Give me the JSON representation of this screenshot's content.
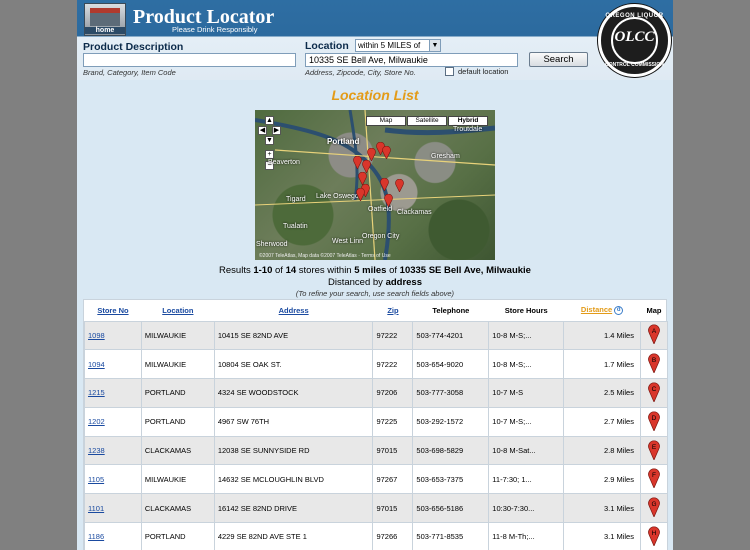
{
  "header": {
    "home_label": "home",
    "title": "Product Locator",
    "subtitle": "Please Drink Responsibly",
    "seal_top": "OREGON LIQUOR",
    "seal_center": "OLCC",
    "seal_bottom": "CONTROL COMMISSION"
  },
  "search": {
    "product_label": "Product Description",
    "product_value": "",
    "product_hint": "Brand, Category, Item Code",
    "location_label": "Location",
    "radius_value": "within 5 MILES of",
    "location_value": "10335 SE Bell Ave, Milwaukie",
    "location_hint": "Address, Zipcode, City, Store No.",
    "default_label": "default location",
    "default_checked": false,
    "button_label": "Search"
  },
  "list_title": "Location List",
  "map": {
    "buttons": [
      "Map",
      "Satellite",
      "Hybrid"
    ],
    "selected": "Hybrid",
    "places": [
      "Portland",
      "Gresham",
      "Beaverton",
      "Tigard",
      "Lake Oswego",
      "Tualatin",
      "Clackamas",
      "Oatfield",
      "Troutdale",
      "Sherwood",
      "West Linn",
      "Oregon City"
    ],
    "copyright": "©2007 TeleAtlas, Map data ©2007 TeleAtlas · Terms of Use"
  },
  "results": {
    "range": "1-10",
    "total": "14",
    "radius": "5 miles",
    "address": "10335 SE Bell Ave, Milwaukie",
    "distanced_by": "address",
    "refine": "(To refine your search, use search fields above)"
  },
  "table": {
    "headers": [
      "Store No",
      "Location",
      "Address",
      "Zip",
      "Telephone",
      "Store Hours",
      "Distance",
      "Map"
    ],
    "rows": [
      {
        "store": "1098",
        "location": "MILWAUKIE",
        "address": "10415 SE 82ND AVE",
        "zip": "97222",
        "phone": "503-774-4201",
        "hours": "10-8 M-S;...",
        "distance": "1.4 Miles",
        "pin": "A"
      },
      {
        "store": "1094",
        "location": "MILWAUKIE",
        "address": "10804 SE OAK ST.",
        "zip": "97222",
        "phone": "503-654-9020",
        "hours": "10-8 M-S;...",
        "distance": "1.7 Miles",
        "pin": "B"
      },
      {
        "store": "1215",
        "location": "PORTLAND",
        "address": "4324 SE WOODSTOCK",
        "zip": "97206",
        "phone": "503-777-3058",
        "hours": "10-7 M-S",
        "distance": "2.5 Miles",
        "pin": "C"
      },
      {
        "store": "1202",
        "location": "PORTLAND",
        "address": "4967 SW 76TH",
        "zip": "97225",
        "phone": "503-292-1572",
        "hours": "10-7 M-S;...",
        "distance": "2.7 Miles",
        "pin": "D"
      },
      {
        "store": "1238",
        "location": "CLACKAMAS",
        "address": "12038 SE SUNNYSIDE RD",
        "zip": "97015",
        "phone": "503-698-5829",
        "hours": "10-8 M-Sat...",
        "distance": "2.8 Miles",
        "pin": "E"
      },
      {
        "store": "1105",
        "location": "MILWAUKIE",
        "address": "14632 SE MCLOUGHLIN BLVD",
        "zip": "97267",
        "phone": "503-653-7375",
        "hours": "11-7:30; 1...",
        "distance": "2.9 Miles",
        "pin": "F"
      },
      {
        "store": "1101",
        "location": "CLACKAMAS",
        "address": "16142 SE 82ND DRIVE",
        "zip": "97015",
        "phone": "503-656-5186",
        "hours": "10:30-7:30...",
        "distance": "3.1 Miles",
        "pin": "G"
      },
      {
        "store": "1186",
        "location": "PORTLAND",
        "address": "4229 SE 82ND AVE STE 1",
        "zip": "97266",
        "phone": "503-771-8535",
        "hours": "11-8 M-Th;...",
        "distance": "3.1 Miles",
        "pin": "H"
      }
    ]
  },
  "colors": {
    "header_blue": "#2c6a9e",
    "page_bg": "#d9e8f3",
    "title_orange": "#e39b18",
    "link_blue": "#1a4aa0",
    "pin_red": "#d9362b"
  }
}
